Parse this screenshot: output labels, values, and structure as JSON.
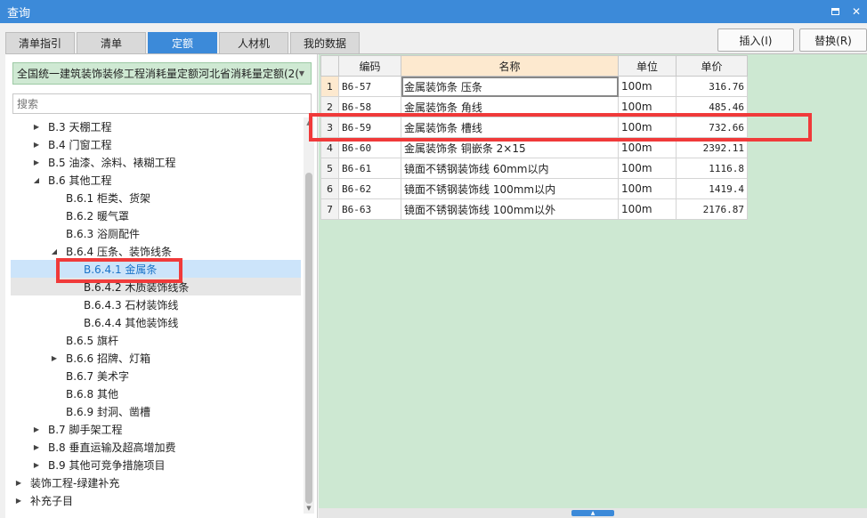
{
  "window": {
    "title": "查询"
  },
  "tabs": [
    {
      "label": "清单指引",
      "active": false
    },
    {
      "label": "清单",
      "active": false
    },
    {
      "label": "定额",
      "active": true
    },
    {
      "label": "人材机",
      "active": false
    },
    {
      "label": "我的数据",
      "active": false
    }
  ],
  "toolbar": {
    "insert_label": "插入(I)",
    "replace_label": "替换(R)"
  },
  "library": {
    "selected": "全国统一建筑装饰装修工程消耗量定额河北省消耗量定额(2("
  },
  "search": {
    "placeholder": "搜索"
  },
  "tree": [
    {
      "label": "B.3 天棚工程",
      "depth": 1,
      "expander": "▶"
    },
    {
      "label": "B.4 门窗工程",
      "depth": 1,
      "expander": "▶"
    },
    {
      "label": "B.5 油漆、涂料、裱糊工程",
      "depth": 1,
      "expander": "▶"
    },
    {
      "label": "B.6 其他工程",
      "depth": 1,
      "expander": "◢"
    },
    {
      "label": "B.6.1 柜类、货架",
      "depth": 2,
      "expander": ""
    },
    {
      "label": "B.6.2 暖气罩",
      "depth": 2,
      "expander": ""
    },
    {
      "label": "B.6.3 浴厕配件",
      "depth": 2,
      "expander": ""
    },
    {
      "label": "B.6.4 压条、装饰线条",
      "depth": 2,
      "expander": "◢"
    },
    {
      "label": "B.6.4.1 金属条",
      "depth": 3,
      "expander": "",
      "selected": true
    },
    {
      "label": "B.6.4.2 木质装饰线条",
      "depth": 3,
      "expander": "",
      "hover": true
    },
    {
      "label": "B.6.4.3 石材装饰线",
      "depth": 3,
      "expander": ""
    },
    {
      "label": "B.6.4.4 其他装饰线",
      "depth": 3,
      "expander": ""
    },
    {
      "label": "B.6.5 旗杆",
      "depth": 2,
      "expander": ""
    },
    {
      "label": "B.6.6 招牌、灯箱",
      "depth": 2,
      "expander": "▶"
    },
    {
      "label": "B.6.7 美术字",
      "depth": 2,
      "expander": ""
    },
    {
      "label": "B.6.8 其他",
      "depth": 2,
      "expander": ""
    },
    {
      "label": "B.6.9 封洞、凿槽",
      "depth": 2,
      "expander": ""
    },
    {
      "label": "B.7 脚手架工程",
      "depth": 1,
      "expander": "▶"
    },
    {
      "label": "B.8 垂直运输及超高增加费",
      "depth": 1,
      "expander": "▶"
    },
    {
      "label": "B.9 其他可竞争措施项目",
      "depth": 1,
      "expander": "▶"
    },
    {
      "label": "装饰工程-绿建补充",
      "depth": 0,
      "expander": "▶"
    },
    {
      "label": "补充子目",
      "depth": 0,
      "expander": "▶"
    }
  ],
  "grid": {
    "columns": [
      "编码",
      "名称",
      "单位",
      "单价"
    ],
    "rows": [
      {
        "index": "1",
        "code": "B6-57",
        "name": "金属装饰条 压条",
        "unit": "100m",
        "price": "316.76",
        "current": true
      },
      {
        "index": "2",
        "code": "B6-58",
        "name": "金属装饰条 角线",
        "unit": "100m",
        "price": "485.46"
      },
      {
        "index": "3",
        "code": "B6-59",
        "name": "金属装饰条 槽线",
        "unit": "100m",
        "price": "732.66"
      },
      {
        "index": "4",
        "code": "B6-60",
        "name": "金属装饰条 铜嵌条 2×15",
        "unit": "100m",
        "price": "2392.11"
      },
      {
        "index": "5",
        "code": "B6-61",
        "name": "镜面不锈钢装饰线 60mm以内",
        "unit": "100m",
        "price": "1116.8"
      },
      {
        "index": "6",
        "code": "B6-62",
        "name": "镜面不锈钢装饰线 100mm以内",
        "unit": "100m",
        "price": "1419.4"
      },
      {
        "index": "7",
        "code": "B6-63",
        "name": "镜面不锈钢装饰线 100mm以外",
        "unit": "100m",
        "price": "2176.87"
      }
    ]
  },
  "icons": {
    "maximize": "maximize-icon",
    "close": "close-icon",
    "dropdown": "chevron-down-icon",
    "expand": "triangle-right-icon",
    "collapse": "triangle-down-icon"
  },
  "colors": {
    "accent": "#3c8ad9",
    "grid_background": "#cde8d2",
    "annotation": "#f03a3a",
    "selected_node": "#cce4fa"
  }
}
